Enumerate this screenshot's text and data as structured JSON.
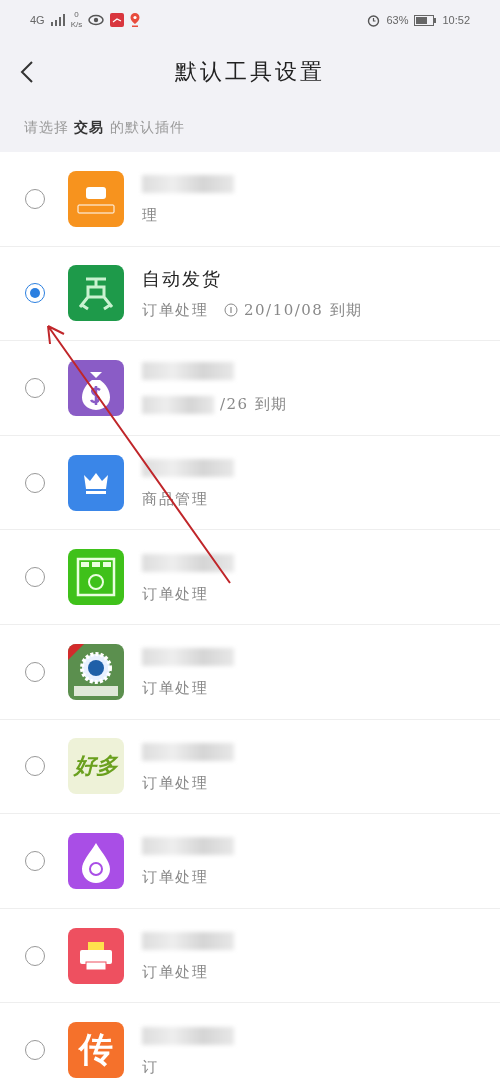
{
  "status_bar": {
    "network": "4G",
    "speed": "0",
    "speed_unit": "K/s",
    "battery": "63%",
    "time": "10:52"
  },
  "header": {
    "title": "默认工具设置"
  },
  "section": {
    "prefix": "请选择",
    "category": "交易",
    "suffix": "的默认插件"
  },
  "items": [
    {
      "kind": "ticket",
      "subtitle": "理",
      "selected": false
    },
    {
      "kind": "truck",
      "title": "自动发货",
      "subtitle": "订单处理",
      "expiry": "20/10/08 到期",
      "selected": true
    },
    {
      "kind": "moneybag",
      "expiry": "/26 到期",
      "selected": false
    },
    {
      "kind": "crown",
      "subtitle": "商品管理",
      "selected": false
    },
    {
      "kind": "shop",
      "subtitle": "订单处理",
      "selected": false
    },
    {
      "kind": "gear",
      "subtitle": "订单处理",
      "selected": false
    },
    {
      "kind": "haoduo",
      "icon_text": "好多",
      "subtitle": "订单处理",
      "selected": false
    },
    {
      "kind": "drop",
      "subtitle": "订单处理",
      "selected": false
    },
    {
      "kind": "printer",
      "subtitle": "订单处理",
      "selected": false
    },
    {
      "kind": "letter",
      "icon_text": "传",
      "subtitle": "订",
      "selected": false
    }
  ]
}
